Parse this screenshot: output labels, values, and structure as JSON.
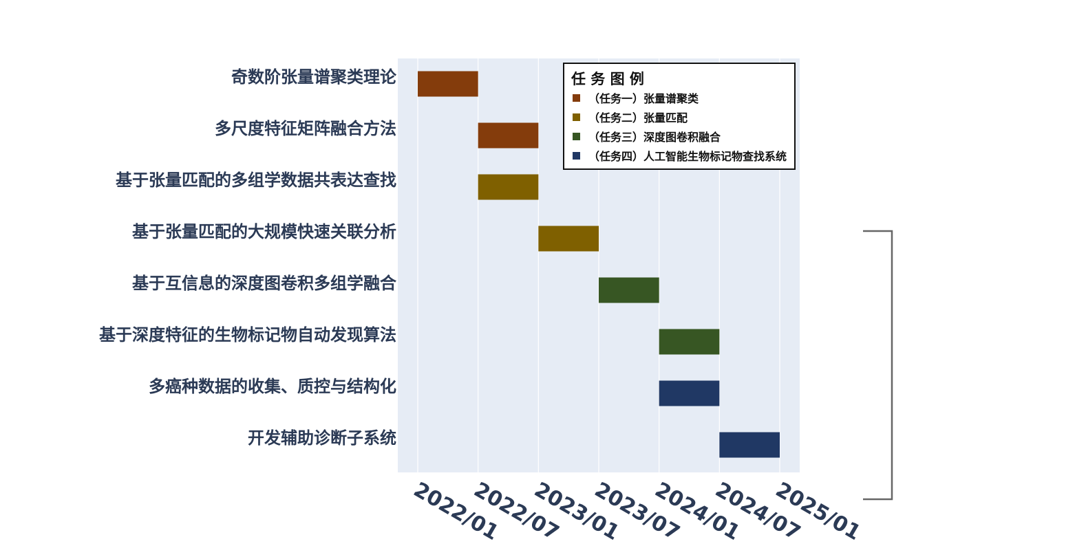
{
  "chart_data": {
    "type": "bar",
    "orientation": "horizontal",
    "subtype": "gantt",
    "grid": true,
    "legend_placement": "top-right",
    "legend_title": "任 务 图 例",
    "x_ticks": [
      "2022/01",
      "2022/07",
      "2023/01",
      "2023/07",
      "2024/01",
      "2024/07",
      "2025/01"
    ],
    "x_range": [
      "2021/11",
      "2025/02"
    ],
    "series": [
      {
        "key": "t1",
        "name": "（任务一）张量谱聚类",
        "color": "#843c0c"
      },
      {
        "key": "t2",
        "name": "（任务二）张量匹配",
        "color": "#7f6000"
      },
      {
        "key": "t3",
        "name": "（任务三）深度图卷积融合",
        "color": "#375623"
      },
      {
        "key": "t4",
        "name": "（任务四）人工智能生物标记物查找系统",
        "color": "#203864"
      }
    ],
    "tasks": [
      {
        "label": "奇数阶张量谱聚类理论",
        "start": "2022/01",
        "end": "2022/07",
        "series": "t1"
      },
      {
        "label": "多尺度特征矩阵融合方法",
        "start": "2022/07",
        "end": "2023/01",
        "series": "t1"
      },
      {
        "label": "基于张量匹配的多组学数据共表达查找",
        "start": "2022/07",
        "end": "2023/01",
        "series": "t2"
      },
      {
        "label": "基于张量匹配的大规模快速关联分析",
        "start": "2023/01",
        "end": "2023/07",
        "series": "t2"
      },
      {
        "label": "基于互信息的深度图卷积多组学融合",
        "start": "2023/07",
        "end": "2024/01",
        "series": "t3"
      },
      {
        "label": "基于深度特征的生物标记物自动发现算法",
        "start": "2024/01",
        "end": "2024/07",
        "series": "t3"
      },
      {
        "label": "多癌种数据的收集、质控与结构化",
        "start": "2024/01",
        "end": "2024/07",
        "series": "t4"
      },
      {
        "label": "开发辅助诊断子系统",
        "start": "2024/07",
        "end": "2025/01",
        "series": "t4"
      }
    ],
    "colors": {
      "plot_background": "#e6ecf5",
      "text": "#2b3a55",
      "grid": "#ffffff",
      "bracket": "#666666"
    }
  }
}
